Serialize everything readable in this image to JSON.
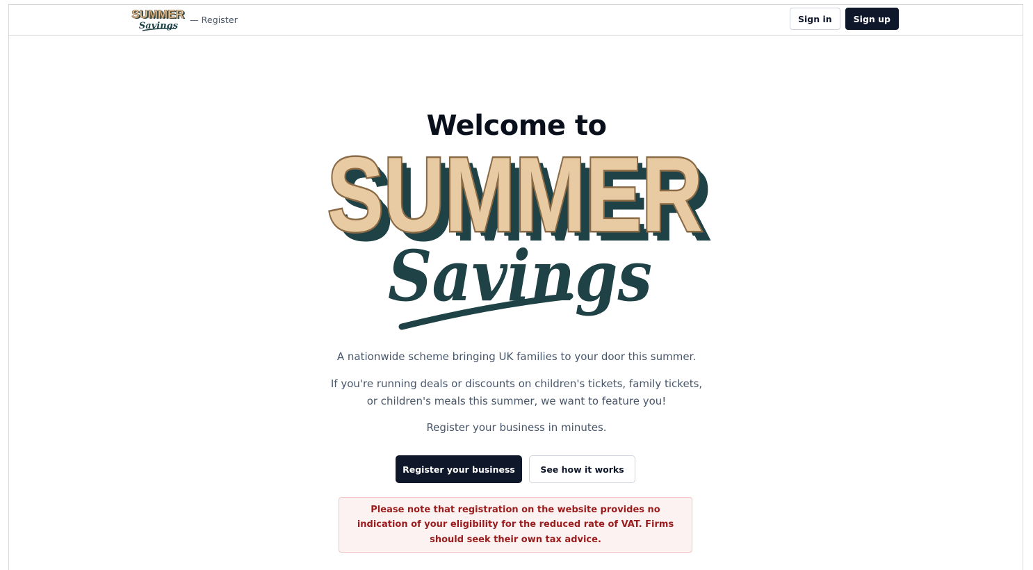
{
  "header": {
    "logo_line1": "SUMMER",
    "logo_line2": "Savings",
    "section": "— Register",
    "sign_in_label": "Sign in",
    "sign_up_label": "Sign up"
  },
  "hero": {
    "welcome": "Welcome to",
    "logo_line1": "SUMMER",
    "logo_line2": "Savings",
    "tagline": "A nationwide scheme bringing UK families to your door this summer.",
    "description_line1": "If you're running deals or discounts on children's tickets, family tickets,",
    "description_line2": "or children's meals this summer, we want to feature you!",
    "register_prompt": "Register your business in minutes."
  },
  "actions": {
    "register_label": "Register your business",
    "how_label": "See how it works"
  },
  "notice": {
    "text": "Please note that registration on the website provides no indication of your eligibility for the reduced rate of VAT. Firms should seek their own tax advice."
  },
  "colors": {
    "logo_beige": "#e9cba3",
    "logo_brown": "#8a6a45",
    "logo_teal": "#1f4246",
    "primary": "#0f172a",
    "notice_text": "#9b1c1c",
    "notice_bg": "#fdf2f2"
  }
}
